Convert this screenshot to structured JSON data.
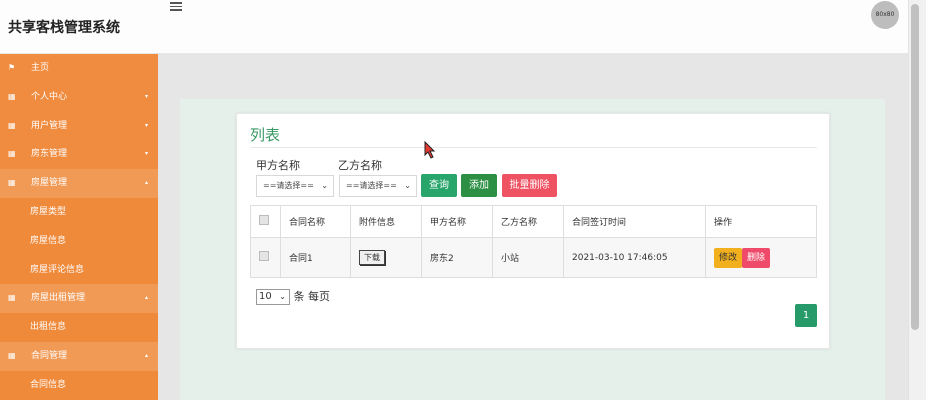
{
  "app": {
    "title": "共享客栈管理系统",
    "avatar_text": "80x80"
  },
  "sidebar": {
    "items": [
      {
        "label": "主页",
        "icon": "flag-icon",
        "caret": ""
      },
      {
        "label": "个人中心",
        "icon": "grid-icon",
        "caret": "▾"
      },
      {
        "label": "用户管理",
        "icon": "grid-icon",
        "caret": "▾"
      },
      {
        "label": "房东管理",
        "icon": "grid-icon",
        "caret": "▾"
      },
      {
        "label": "房屋管理",
        "icon": "grid-icon",
        "caret": "▴"
      },
      {
        "label": "房屋类型",
        "icon": "",
        "caret": ""
      },
      {
        "label": "房屋信息",
        "icon": "",
        "caret": ""
      },
      {
        "label": "房屋评论信息",
        "icon": "",
        "caret": ""
      },
      {
        "label": "房屋出租管理",
        "icon": "grid-icon",
        "caret": "▴"
      },
      {
        "label": "出租信息",
        "icon": "",
        "caret": ""
      },
      {
        "label": "合同管理",
        "icon": "grid-icon",
        "caret": "▴"
      },
      {
        "label": "合同信息",
        "icon": "",
        "caret": ""
      }
    ]
  },
  "main": {
    "title": "列表",
    "filter": {
      "party_a_label": "甲方名称",
      "party_b_label": "乙方名称",
      "party_a_value": "==请选择==",
      "party_b_value": "==请选择=="
    },
    "buttons": {
      "query": "查询",
      "add": "添加",
      "batch_delete": "批量删除"
    },
    "table": {
      "headers": [
        "合同名称",
        "附件信息",
        "甲方名称",
        "乙方名称",
        "合同签订时间",
        "操作"
      ],
      "rows": [
        {
          "name": "合同1",
          "attachment": "下载",
          "party_a": "房东2",
          "party_b": "小站",
          "signed": "2021-03-10 17:46:05",
          "edit": "修改",
          "delete": "删除"
        }
      ]
    },
    "pagination": {
      "page_size": "10",
      "per_page_text": "条 每页",
      "current_page": "1"
    }
  },
  "colors": {
    "sidebar": "#ef8a3b",
    "primary": "#28a56b",
    "danger": "#ef5262",
    "warning": "#f2b01e"
  }
}
